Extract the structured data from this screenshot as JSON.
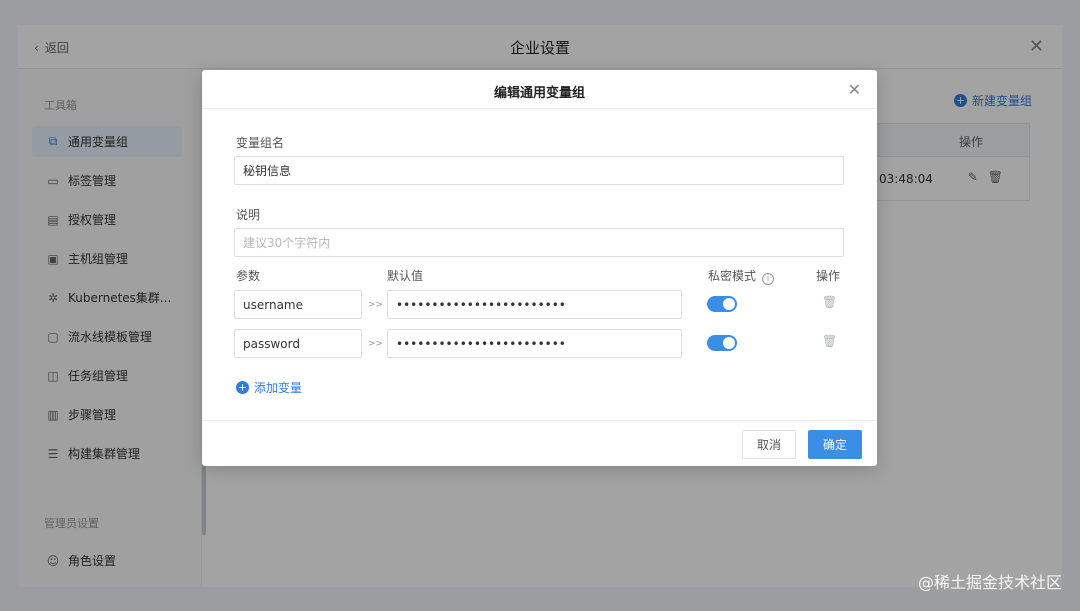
{
  "window": {
    "back_label": "返回",
    "title": "企业设置",
    "close_icon": "close-icon"
  },
  "sidebar": {
    "toolbox_section": "工具箱",
    "admin_section": "管理员设置",
    "items": [
      {
        "label": "通用变量组",
        "icon": "variable-group-icon",
        "active": true
      },
      {
        "label": "标签管理",
        "icon": "tag-icon"
      },
      {
        "label": "授权管理",
        "icon": "auth-icon"
      },
      {
        "label": "主机组管理",
        "icon": "host-group-icon"
      },
      {
        "label": "Kubernetes集群...",
        "icon": "kubernetes-icon"
      },
      {
        "label": "流水线模板管理",
        "icon": "pipeline-template-icon"
      },
      {
        "label": "任务组管理",
        "icon": "task-group-icon"
      },
      {
        "label": "步骤管理",
        "icon": "step-icon"
      },
      {
        "label": "构建集群管理",
        "icon": "build-cluster-icon"
      }
    ],
    "admin_items": [
      {
        "label": "角色设置",
        "icon": "role-icon"
      }
    ]
  },
  "main": {
    "new_group_label": "新建变量组",
    "table": {
      "op_header": "操作",
      "row_time": "03:48:04"
    }
  },
  "modal": {
    "title": "编辑通用变量组",
    "name_label": "变量组名",
    "name_value": "秘钥信息",
    "desc_label": "说明",
    "desc_placeholder": "建议30个字符内",
    "col_param": "参数",
    "col_default": "默认值",
    "col_secret": "私密模式",
    "col_op": "操作",
    "separator": ">>",
    "variables": [
      {
        "name": "username",
        "value": "••••••••••••••••••••••••",
        "secret": true
      },
      {
        "name": "password",
        "value": "••••••••••••••••••••••••",
        "secret": true
      }
    ],
    "add_variable": "添加变量",
    "cancel": "取消",
    "confirm": "确定"
  },
  "watermark": "@稀土掘金技术社区",
  "colors": {
    "accent": "#3a8ee6",
    "link": "#2f7de1",
    "overlay": "rgba(0,0,0,0.36)"
  }
}
